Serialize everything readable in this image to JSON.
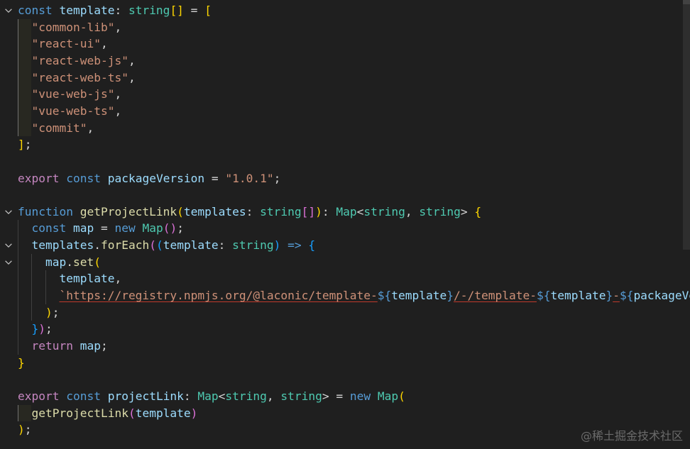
{
  "editor": {
    "language": "typescript",
    "fold_icon": "chevron-down-icon",
    "lines": [
      {
        "fold": true,
        "tokens": [
          [
            "kw",
            "const"
          ],
          [
            "pn",
            " "
          ],
          [
            "var",
            "template"
          ],
          [
            "pn",
            ": "
          ],
          [
            "ty",
            "string"
          ],
          [
            "b1",
            "[]"
          ],
          [
            "pn",
            " = "
          ],
          [
            "b1",
            "["
          ]
        ]
      },
      {
        "fold": false,
        "tokens": [
          [
            "pn",
            "  "
          ],
          [
            "str",
            "\"common-lib\""
          ],
          [
            "pn",
            ","
          ]
        ]
      },
      {
        "fold": false,
        "tokens": [
          [
            "pn",
            "  "
          ],
          [
            "str",
            "\"react-ui\""
          ],
          [
            "pn",
            ","
          ]
        ]
      },
      {
        "fold": false,
        "tokens": [
          [
            "pn",
            "  "
          ],
          [
            "str",
            "\"react-web-js\""
          ],
          [
            "pn",
            ","
          ]
        ]
      },
      {
        "fold": false,
        "tokens": [
          [
            "pn",
            "  "
          ],
          [
            "str",
            "\"react-web-ts\""
          ],
          [
            "pn",
            ","
          ]
        ]
      },
      {
        "fold": false,
        "tokens": [
          [
            "pn",
            "  "
          ],
          [
            "str",
            "\"vue-web-js\""
          ],
          [
            "pn",
            ","
          ]
        ]
      },
      {
        "fold": false,
        "tokens": [
          [
            "pn",
            "  "
          ],
          [
            "str",
            "\"vue-web-ts\""
          ],
          [
            "pn",
            ","
          ]
        ]
      },
      {
        "fold": false,
        "tokens": [
          [
            "pn",
            "  "
          ],
          [
            "str",
            "\"commit\""
          ],
          [
            "pn",
            ","
          ]
        ]
      },
      {
        "fold": false,
        "tokens": [
          [
            "b1",
            "]"
          ],
          [
            "pn",
            ";"
          ]
        ]
      },
      {
        "fold": false,
        "tokens": []
      },
      {
        "fold": false,
        "tokens": [
          [
            "ctl",
            "export"
          ],
          [
            "pn",
            " "
          ],
          [
            "kw",
            "const"
          ],
          [
            "pn",
            " "
          ],
          [
            "var",
            "packageVersion"
          ],
          [
            "pn",
            " = "
          ],
          [
            "str",
            "\"1.0.1\""
          ],
          [
            "pn",
            ";"
          ]
        ]
      },
      {
        "fold": false,
        "tokens": []
      },
      {
        "fold": true,
        "tokens": [
          [
            "kw",
            "function"
          ],
          [
            "pn",
            " "
          ],
          [
            "fn",
            "getProjectLink"
          ],
          [
            "b1",
            "("
          ],
          [
            "var",
            "templates"
          ],
          [
            "pn",
            ": "
          ],
          [
            "ty",
            "string"
          ],
          [
            "b2",
            "[]"
          ],
          [
            "b1",
            ")"
          ],
          [
            "pn",
            ": "
          ],
          [
            "ty",
            "Map"
          ],
          [
            "pn",
            "<"
          ],
          [
            "ty",
            "string"
          ],
          [
            "pn",
            ", "
          ],
          [
            "ty",
            "string"
          ],
          [
            "pn",
            "> "
          ],
          [
            "b1",
            "{"
          ]
        ]
      },
      {
        "fold": false,
        "tokens": [
          [
            "pn",
            "  "
          ],
          [
            "kw",
            "const"
          ],
          [
            "pn",
            " "
          ],
          [
            "var",
            "map"
          ],
          [
            "pn",
            " = "
          ],
          [
            "kw",
            "new"
          ],
          [
            "pn",
            " "
          ],
          [
            "ty",
            "Map"
          ],
          [
            "b2",
            "()"
          ],
          [
            "pn",
            ";"
          ]
        ]
      },
      {
        "fold": true,
        "tokens": [
          [
            "pn",
            "  "
          ],
          [
            "var",
            "templates"
          ],
          [
            "pn",
            "."
          ],
          [
            "fn",
            "forEach"
          ],
          [
            "b2",
            "("
          ],
          [
            "b3",
            "("
          ],
          [
            "var",
            "template"
          ],
          [
            "pn",
            ": "
          ],
          [
            "ty",
            "string"
          ],
          [
            "b3",
            ")"
          ],
          [
            "pn",
            " "
          ],
          [
            "kw",
            "=>"
          ],
          [
            "pn",
            " "
          ],
          [
            "b3",
            "{"
          ]
        ]
      },
      {
        "fold": true,
        "tokens": [
          [
            "pn",
            "    "
          ],
          [
            "var",
            "map"
          ],
          [
            "pn",
            "."
          ],
          [
            "fn",
            "set"
          ],
          [
            "b1",
            "("
          ]
        ]
      },
      {
        "fold": false,
        "tokens": [
          [
            "pn",
            "      "
          ],
          [
            "var",
            "template"
          ],
          [
            "pn",
            ","
          ]
        ]
      },
      {
        "fold": false,
        "tokens": [
          [
            "pn",
            "      "
          ],
          [
            "tpl",
            "`https://registry.npmjs.org/@laconic/template-"
          ],
          [
            "kw",
            "${"
          ],
          [
            "var",
            "template"
          ],
          [
            "kw",
            "}"
          ],
          [
            "tpl",
            "/-/template-"
          ],
          [
            "kw",
            "${"
          ],
          [
            "var",
            "template"
          ],
          [
            "kw",
            "}"
          ],
          [
            "tpl",
            "-"
          ],
          [
            "kw",
            "${"
          ],
          [
            "var",
            "packageVer"
          ]
        ]
      },
      {
        "fold": false,
        "tokens": [
          [
            "pn",
            "    "
          ],
          [
            "b1",
            ")"
          ],
          [
            "pn",
            ";"
          ]
        ]
      },
      {
        "fold": false,
        "tokens": [
          [
            "pn",
            "  "
          ],
          [
            "b3",
            "}"
          ],
          [
            "b2",
            ")"
          ],
          [
            "pn",
            ";"
          ]
        ]
      },
      {
        "fold": false,
        "tokens": [
          [
            "pn",
            "  "
          ],
          [
            "ctl",
            "return"
          ],
          [
            "pn",
            " "
          ],
          [
            "var",
            "map"
          ],
          [
            "pn",
            ";"
          ]
        ]
      },
      {
        "fold": false,
        "tokens": [
          [
            "b1",
            "}"
          ]
        ]
      },
      {
        "fold": false,
        "tokens": []
      },
      {
        "fold": false,
        "tokens": [
          [
            "ctl",
            "export"
          ],
          [
            "pn",
            " "
          ],
          [
            "kw",
            "const"
          ],
          [
            "pn",
            " "
          ],
          [
            "var",
            "projectLink"
          ],
          [
            "pn",
            ": "
          ],
          [
            "ty",
            "Map"
          ],
          [
            "pn",
            "<"
          ],
          [
            "ty",
            "string"
          ],
          [
            "pn",
            ", "
          ],
          [
            "ty",
            "string"
          ],
          [
            "pn",
            "> = "
          ],
          [
            "kw",
            "new"
          ],
          [
            "pn",
            " "
          ],
          [
            "ty",
            "Map"
          ],
          [
            "b1",
            "("
          ]
        ]
      },
      {
        "fold": false,
        "tokens": [
          [
            "pn",
            "  "
          ],
          [
            "fn",
            "getProjectLink"
          ],
          [
            "b2",
            "("
          ],
          [
            "var",
            "template"
          ],
          [
            "b2",
            ")"
          ]
        ]
      },
      {
        "fold": false,
        "tokens": [
          [
            "b1",
            ")"
          ],
          [
            "pn",
            ";"
          ]
        ]
      }
    ]
  },
  "watermark": "@稀土掘金技术社区"
}
